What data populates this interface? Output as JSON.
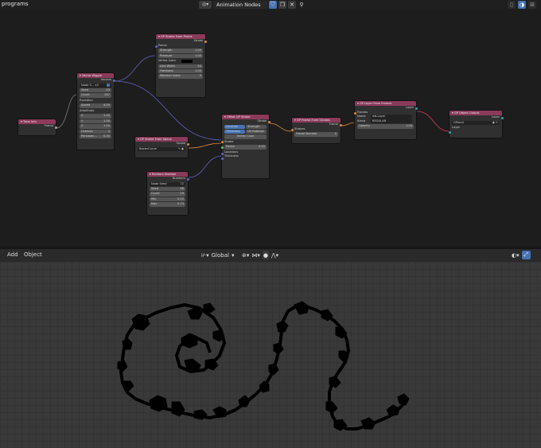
{
  "topbar": {
    "editor_title": "programs",
    "tree_name": "Animation Nodes"
  },
  "nodes": {
    "time_info": {
      "title": "Time Info",
      "out_frame": "Frame"
    },
    "vector_wiggle": {
      "title": "Vector Wiggle",
      "out_vectors": "Vectors",
      "nodes_label": "Node S... x3",
      "seed_label": "Seed",
      "seed": "43",
      "count_label": "Count",
      "count": "267",
      "evolution": "Evolution",
      "speed_label": "Speed",
      "speed": "4.00",
      "amplitude": "Amplitude",
      "x_label": "X",
      "x": "1.00",
      "y_label": "Y",
      "y": "1.00",
      "z_label": "Z",
      "z": "1.00",
      "octaves_label": "Octaves",
      "octaves": "2",
      "persistence_label": "Persisten...",
      "persistence": "0.30"
    },
    "stroke_from_points": {
      "title": "GP Stroke From Points",
      "out_stroke": "Stroke",
      "points": "Points",
      "strength_label": "Strength",
      "strength": "1.00",
      "pressure_label": "Pressure",
      "pressure": "1.00",
      "vertex_color": "Vertex Color",
      "line_width_label": "Line Width",
      "line_width": "24",
      "hardness_label": "Hardness",
      "hardness": "1.00",
      "material_label": "Material Index",
      "material": "0"
    },
    "stroke_from_spline": {
      "title": "GP Stroke From Spline",
      "out_stroke": "Stroke",
      "curve": "BezierCurve"
    },
    "random_number": {
      "title": "Random Number",
      "out_numbers": "Numbers",
      "node_seed_label": "Node Seed",
      "node_seed": "72",
      "seed_label": "Seed",
      "seed": "56",
      "count_label": "Count",
      "count": "29",
      "min_label": "Min",
      "min": "0.25",
      "max_label": "Max",
      "max": "0.74"
    },
    "offset_stroke": {
      "title": "Offset GP Stroke",
      "out_stroke": "Stroke",
      "btn_location": "Location",
      "btn_strength": "Strength",
      "btn_thickness": "Thickness",
      "btn_uv_rotation": "UV Rotation",
      "btn_vertex_color": "Vertex Color",
      "in_stroke": "Stroke",
      "factor_label": "Factor",
      "factor": "0.45",
      "in_locations": "Locations",
      "in_thickness": "Thickness"
    },
    "frame_from_strokes": {
      "title": "GP Frame From Strokes",
      "out_frame": "Frame",
      "in_strokes": "Strokes",
      "frame_number": "Frame Number",
      "frame_value": "0"
    },
    "layer_from_frames": {
      "title": "GP Layer From Frames",
      "out_layer": "Layer",
      "in_frames": "Frames",
      "name_label": "Name",
      "name": "AN-Layer",
      "blend_label": "Blend",
      "blend": "REGULAR",
      "opacity_label": "Opacity",
      "opacity": "1.00"
    },
    "object_output": {
      "title": "GP Object Output",
      "out_layer": "Layer",
      "object": "GPencil",
      "in_layer": "Layer"
    }
  },
  "viewport_header": {
    "add": "Add",
    "object": "Object",
    "orientation": "Global"
  },
  "colors": {
    "node_header": "#8b3a5a",
    "editor_bg": "#1d1d1d",
    "viewport_bg": "#393939",
    "accent": "#4772b3"
  }
}
